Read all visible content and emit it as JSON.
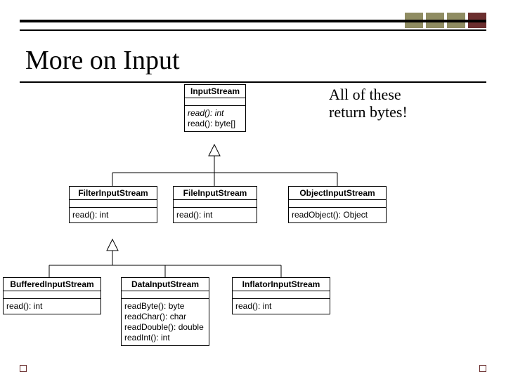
{
  "title": "More on Input",
  "annotation_line1": "All of these",
  "annotation_line2": "return bytes!",
  "classes": {
    "InputStream": {
      "name": "InputStream",
      "ops": [
        {
          "sig": "read(): int",
          "abstract": true
        },
        {
          "sig": "read(): byte[]",
          "abstract": false
        }
      ]
    },
    "FilterInputStream": {
      "name": "FilterInputStream",
      "ops": [
        {
          "sig": "read(): int",
          "abstract": false
        }
      ]
    },
    "FileInputStream": {
      "name": "FileInputStream",
      "ops": [
        {
          "sig": "read(): int",
          "abstract": false
        }
      ]
    },
    "ObjectInputStream": {
      "name": "ObjectInputStream",
      "ops": [
        {
          "sig": "readObject(): Object",
          "abstract": false
        }
      ]
    },
    "BufferedInputStream": {
      "name": "BufferedInputStream",
      "ops": [
        {
          "sig": "read(): int",
          "abstract": false
        }
      ]
    },
    "DataInputStream": {
      "name": "DataInputStream",
      "ops": [
        {
          "sig": "readByte(): byte",
          "abstract": false
        },
        {
          "sig": "readChar(): char",
          "abstract": false
        },
        {
          "sig": "readDouble(): double",
          "abstract": false
        },
        {
          "sig": "readInt(): int",
          "abstract": false
        }
      ]
    },
    "InflatorInputStream": {
      "name": "InflatorInputStream",
      "ops": [
        {
          "sig": "read(): int",
          "abstract": false
        }
      ]
    }
  }
}
